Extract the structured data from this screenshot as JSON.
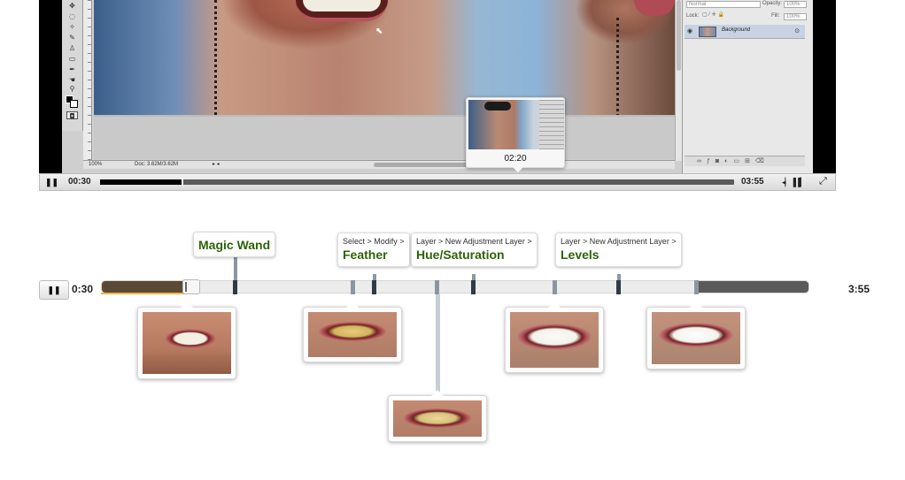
{
  "player": {
    "current_time": "00:30",
    "duration": "03:55",
    "progress": 0.13,
    "pause_icon": "❚❚",
    "volume_icon": "◂▏▐▐▎",
    "fullscreen_icon": "⤢",
    "preview_time": "02:20",
    "photoshop": {
      "zoom": "100%",
      "doc_size": "Doc: 3.62M/3.62M",
      "blend_mode": "Normal",
      "opacity_label": "Opacity:",
      "opacity_value": "100%",
      "lock_label": "Lock:",
      "fill_label": "Fill:",
      "fill_value": "100%",
      "layer_name": "Background",
      "layer_lock_icon": "lock-icon"
    }
  },
  "timeline": {
    "pause_icon": "❚❚",
    "start_time": "0:30",
    "end_time": "3:55",
    "colors": {
      "played": "#5a4a35",
      "buffered_end": "#5a5a5a",
      "marker": "#2f3b46",
      "stem": "#8c96a3",
      "chapter_title": "#2d620a"
    },
    "chapters": [
      {
        "menu_path": "",
        "title": "Magic Wand"
      },
      {
        "menu_path": "Select > Modify >",
        "title": "Feather"
      },
      {
        "menu_path": "Layer > New Adjustment Layer >",
        "title": "Hue/Saturation"
      },
      {
        "menu_path": "Layer > New Adjustment Layer >",
        "title": "Levels"
      }
    ],
    "thumbnails": [
      {
        "label": "original-smile"
      },
      {
        "label": "selected-teeth"
      },
      {
        "label": "hue-saturation-teeth"
      },
      {
        "label": "whitened-teeth"
      },
      {
        "label": "levels-teeth"
      }
    ]
  }
}
